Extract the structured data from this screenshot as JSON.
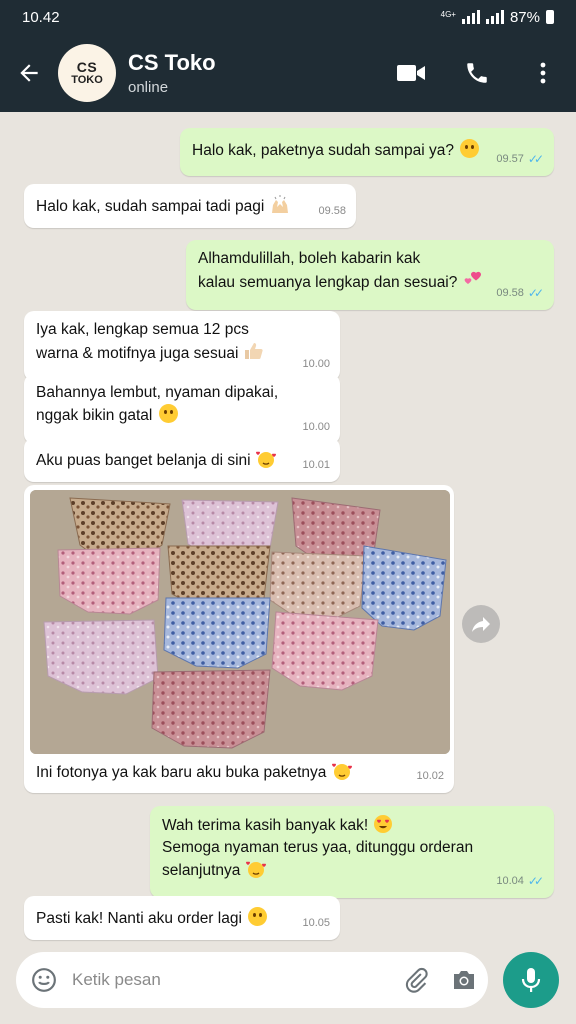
{
  "status_bar": {
    "time": "10.42",
    "network": "4G+",
    "battery": "87%"
  },
  "header": {
    "avatar_line1": "CS",
    "avatar_line2": "TOKO",
    "name": "CS Toko",
    "presence": "online"
  },
  "messages": [
    {
      "dir": "out",
      "text": "Halo kak, paketnya sudah sampai ya?",
      "emoji": "smile",
      "time": "09.57",
      "ticks": "✓✓"
    },
    {
      "dir": "in",
      "text": "Halo kak, sudah sampai tadi pagi",
      "emoji": "raised-hands",
      "time": "09.58"
    },
    {
      "dir": "out",
      "text_line1": "Alhamdulillah, boleh kabarin kak",
      "text_line2": "kalau semuanya lengkap dan sesuai?",
      "emoji": "two-hearts",
      "time": "09.58",
      "ticks": "✓✓"
    },
    {
      "dir": "in",
      "text_line1": "Iya kak, lengkap semua 12 pcs",
      "text_line2": "warna & motifnya juga sesuai",
      "emoji": "thumbs-up",
      "time": "10.00"
    },
    {
      "dir": "in",
      "text_line1": "Bahannya lembut, nyaman dipakai,",
      "text_line2": "nggak bikin gatal",
      "emoji": "smile",
      "time": "10.00"
    },
    {
      "dir": "in",
      "text": "Aku puas banget belanja di sini",
      "emoji": "smiling-hearts",
      "time": "10.01"
    },
    {
      "dir": "in",
      "kind": "photo",
      "caption": "Ini fotonya ya kak baru aku buka paketnya",
      "emoji": "smiling-hearts",
      "time": "10.02"
    },
    {
      "dir": "out",
      "text_line1": "Wah terima kasih banyak kak!",
      "text_line2": "Semoga nyaman terus yaa, ditunggu orderan",
      "text_line3": "selanjutnya",
      "emoji_1": "heart-eyes",
      "emoji_3": "smiling-hearts",
      "time": "10.04",
      "ticks": "✓✓"
    },
    {
      "dir": "in",
      "text": "Pasti kak! Nanti aku order lagi",
      "emoji": "smile",
      "time": "10.05"
    }
  ],
  "composer": {
    "placeholder": "Ketik pesan"
  },
  "icons": {
    "back": "arrow-left-icon",
    "video": "video-call-icon",
    "call": "phone-icon",
    "menu": "more-vert-icon",
    "emoji": "emoji-icon",
    "attach": "paperclip-icon",
    "camera": "camera-icon",
    "mic": "microphone-icon",
    "forward": "forward-icon"
  },
  "colors": {
    "header": "#1f2c34",
    "outgoing_bubble": "#dcf8c6",
    "incoming_bubble": "#ffffff",
    "chat_bg": "#e8e4de",
    "mic_button": "#1c9c8a",
    "read_ticks": "#4fb6ec"
  }
}
